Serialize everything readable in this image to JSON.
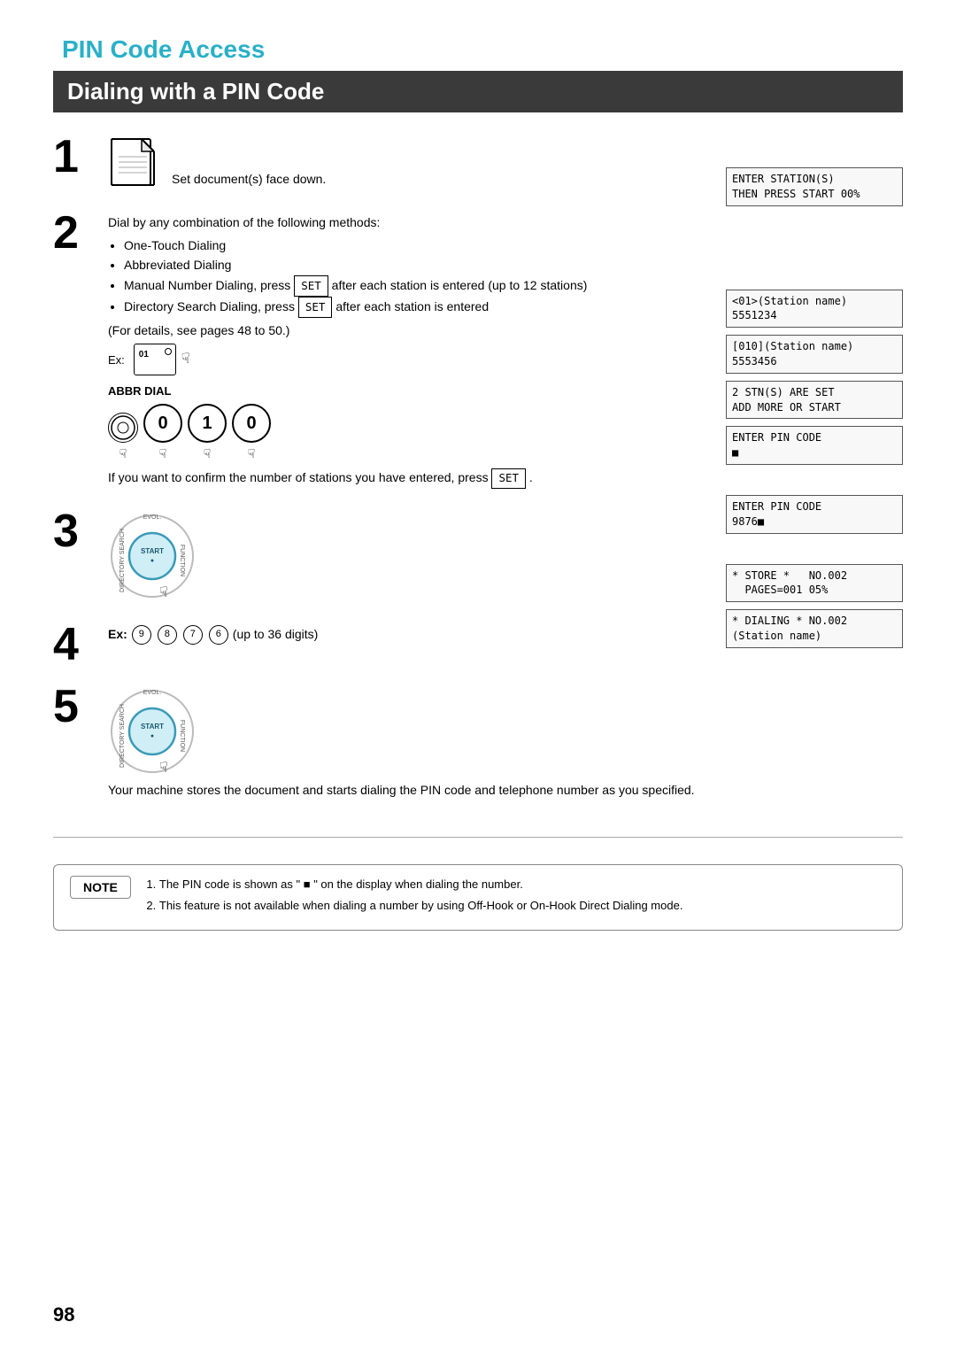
{
  "page": {
    "title": "PIN Code Access",
    "section_title": "Dialing with a PIN Code",
    "page_number": "98"
  },
  "steps": [
    {
      "number": "1",
      "text": "Set document(s) face down."
    },
    {
      "number": "2",
      "intro": "Dial by any combination of the following methods:",
      "bullets": [
        "One-Touch Dialing",
        "Abbreviated Dialing",
        "Manual Number Dialing, press  SET  after each station is entered (up to 12 stations)",
        "Directory Search Dialing, press  SET  after each station is entered",
        "(For details, see pages 48 to 50.)"
      ],
      "ex_label": "Ex:",
      "abbr_dial_label": "ABBR DIAL",
      "dial_digits": [
        "0",
        "1",
        "0"
      ],
      "confirm_text": "If you want to confirm the number of stations you have entered, press",
      "set_label": "SET"
    },
    {
      "number": "3",
      "text": ""
    },
    {
      "number": "4",
      "ex_label": "Ex:",
      "digits": [
        "9",
        "8",
        "7",
        "6"
      ],
      "suffix": "(up to 36 digits)"
    },
    {
      "number": "5",
      "text": "Your machine stores the document and starts dialing the PIN code and telephone number as you specified."
    }
  ],
  "right_displays": [
    {
      "id": "enter_station",
      "lines": [
        "ENTER STATION(S)",
        "THEN PRESS START 00%"
      ]
    },
    {
      "id": "station1",
      "lines": [
        "<01>(Station name)",
        "5551234"
      ]
    },
    {
      "id": "station2",
      "lines": [
        "[010](Station name)",
        "5553456"
      ]
    },
    {
      "id": "stns_set",
      "lines": [
        " 2 STN(S) ARE SET",
        "ADD MORE OR START"
      ]
    },
    {
      "id": "enter_pin",
      "lines": [
        "ENTER PIN CODE",
        "■"
      ]
    },
    {
      "id": "enter_pin_code",
      "lines": [
        "ENTER PIN CODE",
        "9876■"
      ]
    },
    {
      "id": "store",
      "lines": [
        "* STORE *   NO.002",
        "  PAGES=001  05%"
      ]
    },
    {
      "id": "dialing",
      "lines": [
        "* DIALING *  NO.002",
        "(Station name)"
      ]
    }
  ],
  "note": {
    "label": "NOTE",
    "items": [
      "The PIN code is shown as \" ■ \" on the display when dialing the number.",
      "This feature is not available when dialing a number by using Off-Hook or On-Hook Direct Dialing mode."
    ]
  },
  "icons": {
    "document": "document-icon",
    "start_button": "start-button-icon",
    "finger": "finger-pointer-icon"
  }
}
